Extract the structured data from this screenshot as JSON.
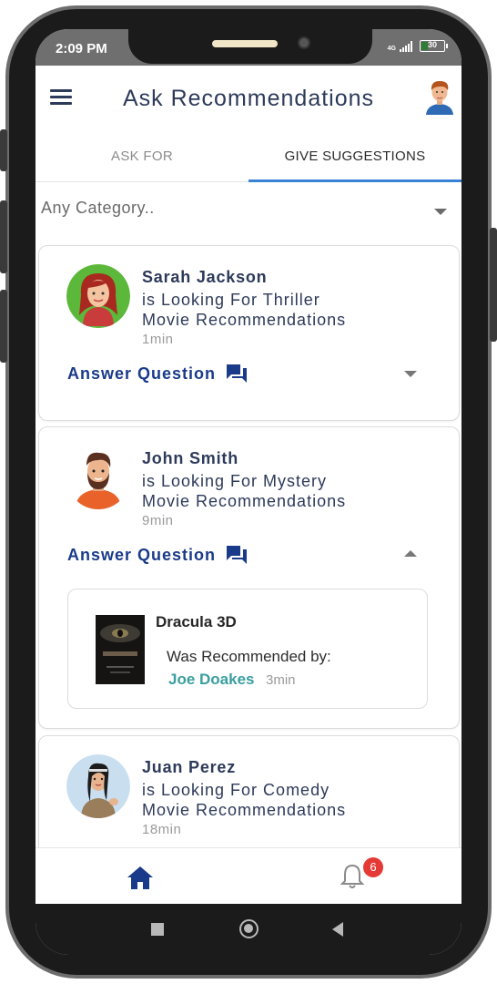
{
  "status_bar": {
    "time": "2:09 PM",
    "network": "4G",
    "battery": "30",
    "battery_level_percent": 30
  },
  "app_bar": {
    "title": "Ask Recommendations",
    "menu_icon": "hamburger-menu-icon",
    "profile_icon": "user-avatar-icon"
  },
  "tabs": [
    {
      "label": "ASK FOR",
      "active": false
    },
    {
      "label": "GIVE SUGGESTIONS",
      "active": true
    }
  ],
  "category": {
    "placeholder": "Any Category..",
    "icon": "caret-down-icon"
  },
  "requests": [
    {
      "name": "Sarah Jackson",
      "line1": "is Looking For Thriller",
      "line2": "Movie Recommendations",
      "time": "1min",
      "action_label": "Answer Question",
      "action_icon": "chat-bubbles-icon",
      "expanded": false
    },
    {
      "name": "John Smith",
      "line1": "is Looking For Mystery",
      "line2": "Movie Recommendations",
      "time": "9min",
      "action_label": "Answer Question",
      "action_icon": "chat-bubbles-icon",
      "expanded": true,
      "recommendation": {
        "title": "Dracula 3D",
        "by_label": "Was Recommended by:",
        "user": "Joe Doakes",
        "time": "3min"
      }
    },
    {
      "name": "Juan Perez",
      "line1": "is Looking For Comedy",
      "line2": "Movie Recommendations",
      "time": "18min"
    }
  ],
  "bottom_nav": {
    "home_icon": "home-icon",
    "bell_icon": "bell-icon",
    "notification_count": "6"
  },
  "system_nav": {
    "recents_icon": "square-icon",
    "home_icon": "circle-icon",
    "back_icon": "triangle-back-icon"
  },
  "colors": {
    "primary_text": "#2d3a5a",
    "action": "#1a3a8a",
    "tab_indicator": "#3a82d6",
    "recommender": "#3a9ea0",
    "badge": "#e53935"
  }
}
